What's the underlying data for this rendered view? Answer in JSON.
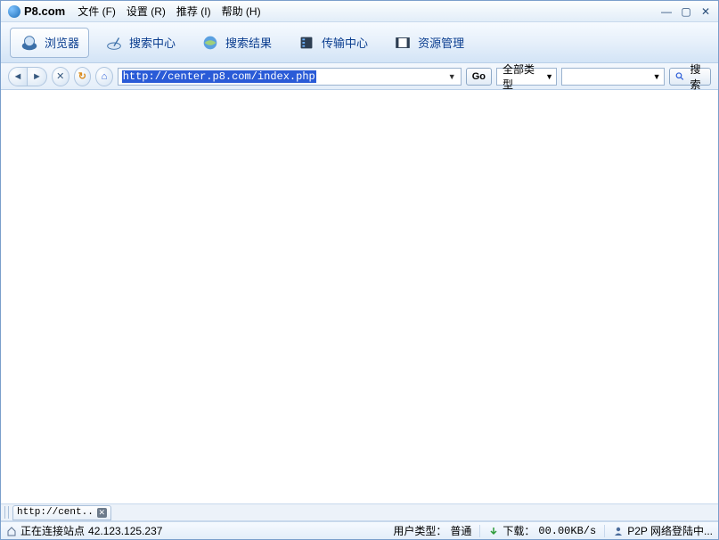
{
  "app": {
    "name": "P8.com"
  },
  "menu": {
    "file": "文件 (F)",
    "settings": "设置 (R)",
    "recommend": "推荐 (I)",
    "help": "帮助 (H)"
  },
  "toolbar": {
    "browser": "浏览器",
    "search_center": "搜索中心",
    "search_result": "搜索结果",
    "transfer_center": "传输中心",
    "resource_manager": "资源管理"
  },
  "nav": {
    "url": "http://center.p8.com/index.php",
    "go_label": "Go",
    "type_label": "全部类型",
    "search_value": "",
    "search_btn": "搜索"
  },
  "tab": {
    "label": "http://cent.."
  },
  "status": {
    "connecting": "正在连接站点",
    "ip": "42.123.125.237",
    "user_type_label": "用户类型：",
    "user_type_value": "普通",
    "download_label": "下载：",
    "download_value": "00.00KB/s",
    "p2p": "P2P 网络登陆中..."
  },
  "colors": {
    "link_blue": "#0a3d8f",
    "selection": "#2a5bd7"
  }
}
